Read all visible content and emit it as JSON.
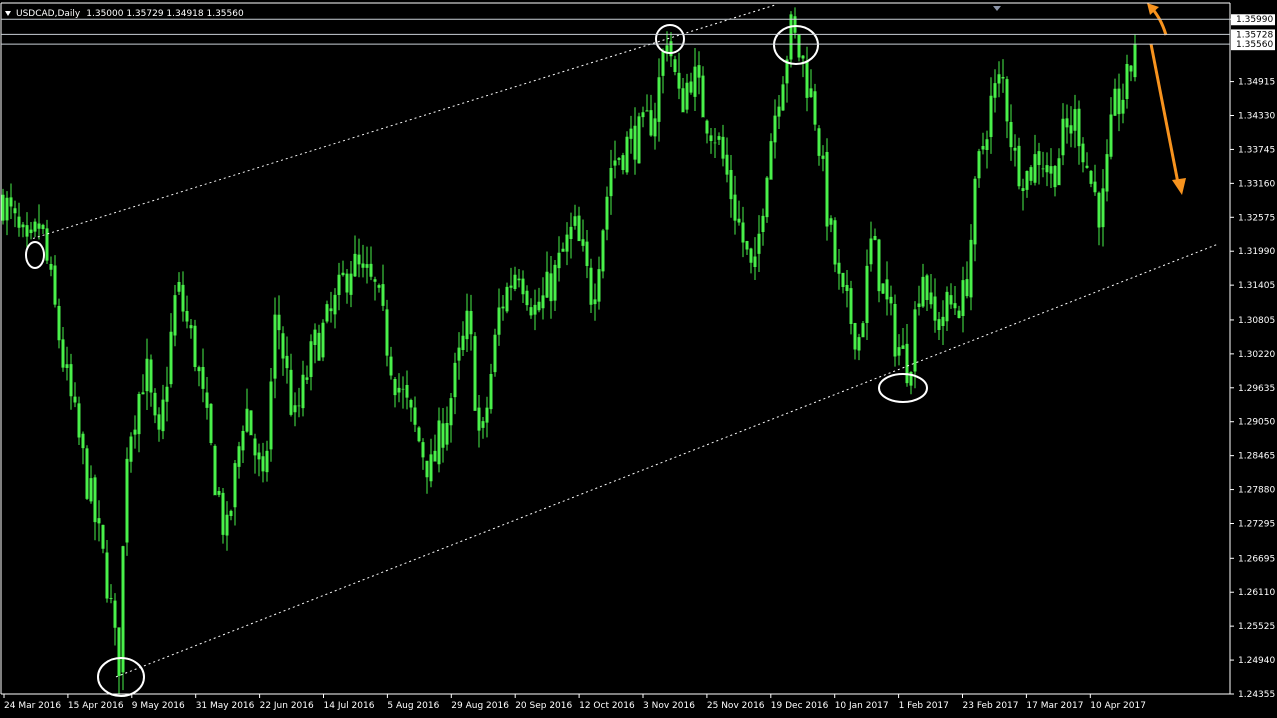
{
  "header": {
    "symbol_timeframe": "USDCAD,Daily",
    "ohlc": "1.35000 1.35729 1.34918 1.35560"
  },
  "colors": {
    "background": "#000000",
    "candle": "#49f04a",
    "axis": "#ffffff",
    "channel_line": "#ffffff",
    "annotation_circle": "#ffffff",
    "arrow": "#f7931e",
    "level_line": "#c9cfd6",
    "bid_line": "#c9cfd6"
  },
  "icons": {
    "menu": "triangle-down-icon",
    "shift": "triangle-marker-icon"
  },
  "chart_data": {
    "type": "candlestick",
    "title": "USDCAD,Daily",
    "x_ticks": [
      "24 Mar 2016",
      "15 Apr 2016",
      "9 May 2016",
      "31 May 2016",
      "22 Jun 2016",
      "14 Jul 2016",
      "5 Aug 2016",
      "29 Aug 2016",
      "20 Sep 2016",
      "12 Oct 2016",
      "3 Nov 2016",
      "25 Nov 2016",
      "19 Dec 2016",
      "10 Jan 2017",
      "1 Feb 2017",
      "23 Feb 2017",
      "17 Mar 2017",
      "10 Apr 2017"
    ],
    "y_ticks": [
      "1.35990",
      "1.34915",
      "1.34330",
      "1.33745",
      "1.33160",
      "1.32575",
      "1.31990",
      "1.31405",
      "1.30805",
      "1.30220",
      "1.29635",
      "1.29050",
      "1.28465",
      "1.27880",
      "1.27295",
      "1.26695",
      "1.26110",
      "1.25525",
      "1.24940",
      "1.24355"
    ],
    "ylim": [
      1.24355,
      1.3627
    ],
    "horizontal_levels": [
      {
        "value": 1.3599,
        "label": "1.35990"
      },
      {
        "value": 1.35728,
        "label": "1.35728"
      }
    ],
    "bid": {
      "value": 1.3556,
      "label": "1.35560"
    },
    "last_bar": {
      "open": 1.35,
      "high": 1.35729,
      "low": 1.34918,
      "close": 1.3556
    },
    "channel": {
      "upper": {
        "from": {
          "bar": 30,
          "price": 1.3221
        },
        "to": {
          "bar": 315,
          "price": 1.3627
        }
      },
      "lower": {
        "from": {
          "bar": 113,
          "price": 1.2465
        },
        "to": {
          "bar": 1216,
          "price": 1.3212
        }
      }
    },
    "anchor_points": [
      {
        "label": "Mar 2016 high",
        "price": 1.3245
      },
      {
        "label": "May 2016 low",
        "price": 1.2465
      },
      {
        "label": "Nov 2016 high",
        "price": 1.3599
      },
      {
        "label": "Dec 2016 high",
        "price": 1.3599
      },
      {
        "label": "Jan/Feb 2017 low",
        "price": 1.2969
      }
    ],
    "arrows": [
      {
        "direction": "up",
        "meaning": "breakout above resistance"
      },
      {
        "direction": "down",
        "meaning": "rejection at resistance"
      }
    ],
    "ohlc_approx_path": [
      {
        "t": 0.0,
        "price": 1.329
      },
      {
        "t": 0.02,
        "price": 1.319
      },
      {
        "t": 0.03,
        "price": 1.325
      },
      {
        "t": 0.05,
        "price": 1.299
      },
      {
        "t": 0.07,
        "price": 1.278
      },
      {
        "t": 0.085,
        "price": 1.262
      },
      {
        "t": 0.093,
        "price": 1.247
      },
      {
        "t": 0.1,
        "price": 1.287
      },
      {
        "t": 0.115,
        "price": 1.3
      },
      {
        "t": 0.125,
        "price": 1.285
      },
      {
        "t": 0.14,
        "price": 1.314
      },
      {
        "t": 0.155,
        "price": 1.302
      },
      {
        "t": 0.17,
        "price": 1.282
      },
      {
        "t": 0.18,
        "price": 1.27
      },
      {
        "t": 0.195,
        "price": 1.294
      },
      {
        "t": 0.21,
        "price": 1.278
      },
      {
        "t": 0.22,
        "price": 1.31
      },
      {
        "t": 0.235,
        "price": 1.29
      },
      {
        "t": 0.25,
        "price": 1.303
      },
      {
        "t": 0.265,
        "price": 1.309
      },
      {
        "t": 0.28,
        "price": 1.318
      },
      {
        "t": 0.3,
        "price": 1.313
      },
      {
        "t": 0.315,
        "price": 1.299
      },
      {
        "t": 0.33,
        "price": 1.29
      },
      {
        "t": 0.345,
        "price": 1.282
      },
      {
        "t": 0.36,
        "price": 1.294
      },
      {
        "t": 0.375,
        "price": 1.308
      },
      {
        "t": 0.385,
        "price": 1.285
      },
      {
        "t": 0.4,
        "price": 1.31
      },
      {
        "t": 0.415,
        "price": 1.318
      },
      {
        "t": 0.43,
        "price": 1.309
      },
      {
        "t": 0.445,
        "price": 1.316
      },
      {
        "t": 0.46,
        "price": 1.324
      },
      {
        "t": 0.475,
        "price": 1.312
      },
      {
        "t": 0.49,
        "price": 1.335
      },
      {
        "t": 0.505,
        "price": 1.339
      },
      {
        "t": 0.515,
        "price": 1.34
      },
      {
        "t": 0.525,
        "price": 1.344
      },
      {
        "t": 0.535,
        "price": 1.358
      },
      {
        "t": 0.545,
        "price": 1.345
      },
      {
        "t": 0.555,
        "price": 1.351
      },
      {
        "t": 0.565,
        "price": 1.344
      },
      {
        "t": 0.575,
        "price": 1.34
      },
      {
        "t": 0.59,
        "price": 1.327
      },
      {
        "t": 0.605,
        "price": 1.314
      },
      {
        "t": 0.615,
        "price": 1.335
      },
      {
        "t": 0.625,
        "price": 1.348
      },
      {
        "t": 0.635,
        "price": 1.358
      },
      {
        "t": 0.645,
        "price": 1.352
      },
      {
        "t": 0.655,
        "price": 1.343
      },
      {
        "t": 0.665,
        "price": 1.325
      },
      {
        "t": 0.675,
        "price": 1.312
      },
      {
        "t": 0.69,
        "price": 1.305
      },
      {
        "t": 0.7,
        "price": 1.322
      },
      {
        "t": 0.71,
        "price": 1.312
      },
      {
        "t": 0.72,
        "price": 1.304
      },
      {
        "t": 0.73,
        "price": 1.3
      },
      {
        "t": 0.74,
        "price": 1.318
      },
      {
        "t": 0.75,
        "price": 1.307
      },
      {
        "t": 0.76,
        "price": 1.31
      },
      {
        "t": 0.775,
        "price": 1.312
      },
      {
        "t": 0.785,
        "price": 1.333
      },
      {
        "t": 0.795,
        "price": 1.345
      },
      {
        "t": 0.805,
        "price": 1.35
      },
      {
        "t": 0.815,
        "price": 1.336
      },
      {
        "t": 0.825,
        "price": 1.333
      },
      {
        "t": 0.835,
        "price": 1.337
      },
      {
        "t": 0.845,
        "price": 1.333
      },
      {
        "t": 0.855,
        "price": 1.34
      },
      {
        "t": 0.865,
        "price": 1.343
      },
      {
        "t": 0.875,
        "price": 1.333
      },
      {
        "t": 0.885,
        "price": 1.326
      },
      {
        "t": 0.895,
        "price": 1.344
      },
      {
        "t": 0.905,
        "price": 1.348
      },
      {
        "t": 0.912,
        "price": 1.3556
      }
    ]
  }
}
